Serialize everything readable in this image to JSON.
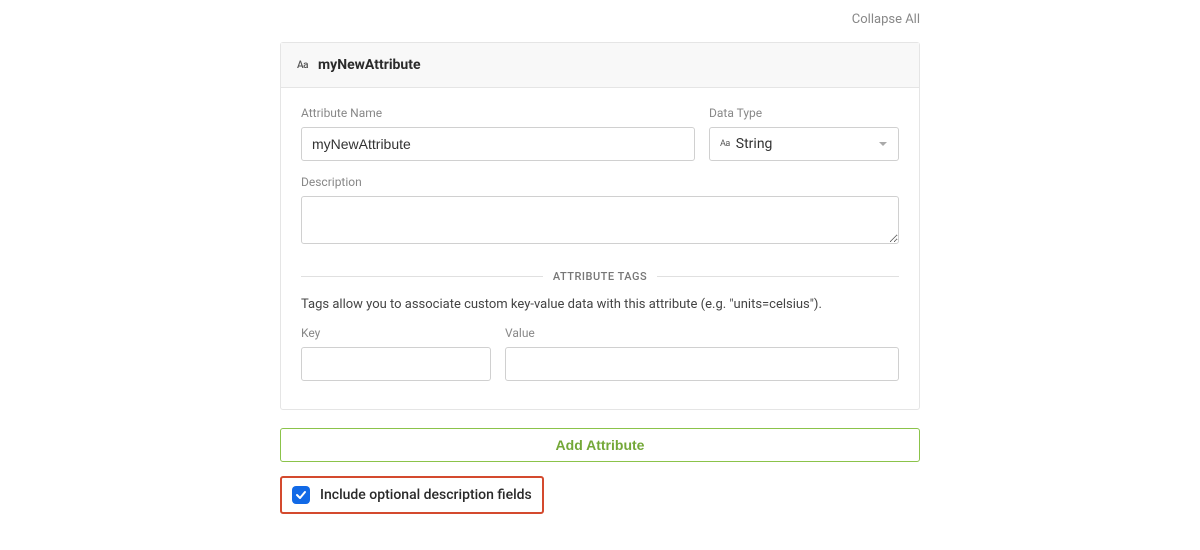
{
  "actions": {
    "collapse_all": "Collapse All",
    "add_attribute": "Add Attribute"
  },
  "attribute": {
    "header_title": "myNewAttribute",
    "name": {
      "label": "Attribute Name",
      "value": "myNewAttribute"
    },
    "data_type": {
      "label": "Data Type",
      "value": "String"
    },
    "description": {
      "label": "Description",
      "value": ""
    }
  },
  "tags": {
    "heading": "ATTRIBUTE TAGS",
    "help": "Tags allow you to associate custom key-value data with this attribute (e.g. \"units=celsius\").",
    "key_label": "Key",
    "value_label": "Value",
    "key_value": "",
    "value_value": ""
  },
  "options": {
    "include_description_label": "Include optional description fields",
    "include_description_checked": true
  }
}
